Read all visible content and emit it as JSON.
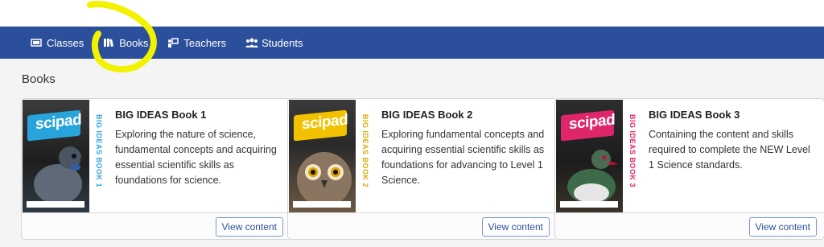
{
  "nav": {
    "items": [
      {
        "label": "Classes",
        "icon": "classes-icon"
      },
      {
        "label": "Books",
        "icon": "books-icon"
      },
      {
        "label": "Teachers",
        "icon": "teachers-icon"
      },
      {
        "label": "Students",
        "icon": "students-icon"
      }
    ]
  },
  "page": {
    "title": "Books"
  },
  "books": [
    {
      "title": "BIG IDEAS Book 1",
      "description": "Exploring the nature of science, fundamental concepts and acquiring essential scientific skills as foundations for science.",
      "cover_logo": "scipad",
      "spine": "BIG IDEAS BOOK 1",
      "accent": "#29a3dc",
      "button": "View content"
    },
    {
      "title": "BIG IDEAS Book 2",
      "description": "Exploring fundamental concepts and acquiring essential scientific skills as foundations for advancing to Level 1 Science.",
      "cover_logo": "scipad",
      "spine": "BIG IDEAS BOOK 2",
      "accent": "#f2c200",
      "button": "View content"
    },
    {
      "title": "BIG IDEAS Book 3",
      "description": "Containing the content and skills required to complete the NEW Level 1 Science standards.",
      "cover_logo": "scipad",
      "spine": "BIG IDEAS BOOK 3",
      "accent": "#e0266b",
      "button": "View content"
    }
  ],
  "colors": {
    "nav_bg": "#2c4f9c",
    "main_bg": "#f4f4f4",
    "highlight": "#f2f200"
  }
}
